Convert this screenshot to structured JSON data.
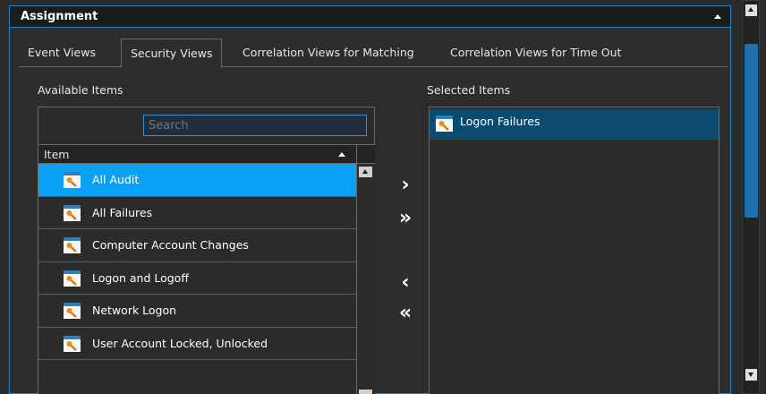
{
  "panel": {
    "title": "Assignment"
  },
  "tabs": [
    {
      "label": "Event Views",
      "active": false
    },
    {
      "label": "Security Views",
      "active": true
    },
    {
      "label": "Correlation Views for Matching",
      "active": false
    },
    {
      "label": "Correlation Views for Time Out",
      "active": false
    }
  ],
  "available": {
    "label": "Available Items",
    "search_placeholder": "Search",
    "column_header": "Item",
    "items": [
      {
        "label": "All Audit",
        "selected": true
      },
      {
        "label": "All Failures",
        "selected": false
      },
      {
        "label": "Computer Account Changes",
        "selected": false
      },
      {
        "label": "Logon and Logoff",
        "selected": false
      },
      {
        "label": "Network Logon",
        "selected": false
      },
      {
        "label": "User Account Locked, Unlocked",
        "selected": false
      }
    ]
  },
  "transfer": {
    "add": "›",
    "add_all": "»",
    "remove": "‹",
    "remove_all": "«"
  },
  "selected": {
    "label": "Selected Items",
    "items": [
      {
        "label": "Logon Failures"
      }
    ]
  },
  "colors": {
    "accent": "#0aa0f5",
    "selected_dark": "#0c4a6e",
    "border_blue": "#2a7fc0",
    "icon_orange": "#f28c00"
  },
  "icons": {
    "item_icon": "security-view-key-icon"
  }
}
